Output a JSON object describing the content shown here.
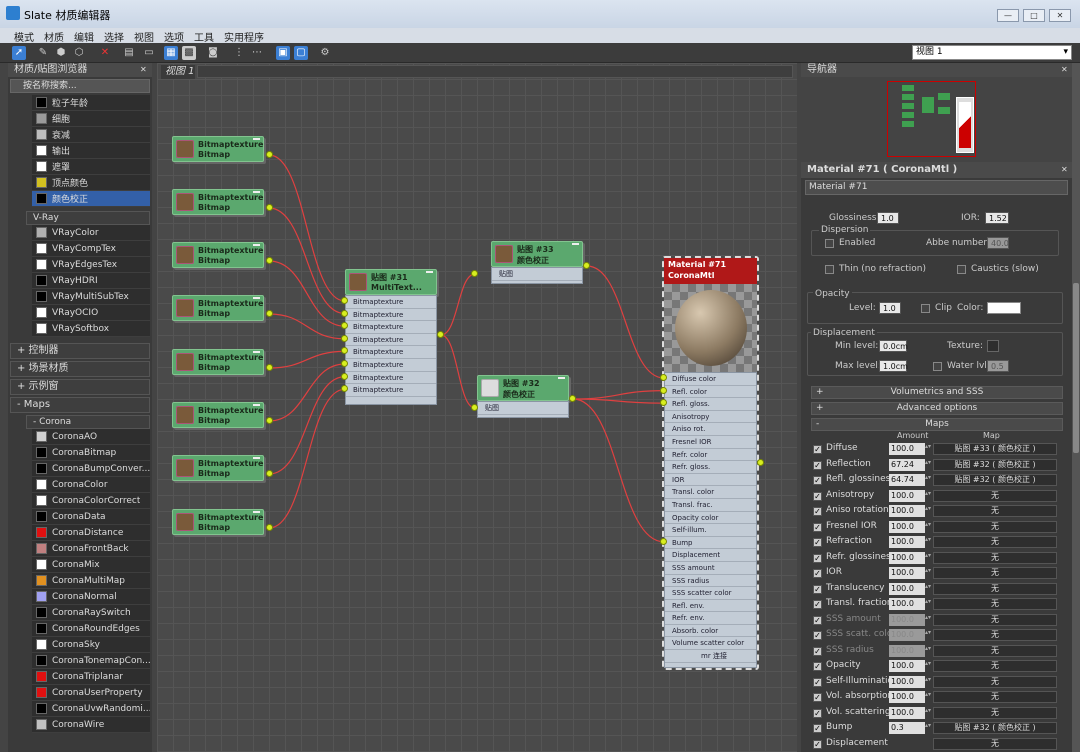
{
  "window": {
    "title": "Slate 材质编辑器"
  },
  "menu": [
    "模式",
    "材质",
    "编辑",
    "选择",
    "视图",
    "选项",
    "工具",
    "实用程序"
  ],
  "toolbar": {
    "view_select": "视图 1"
  },
  "browser": {
    "title": "材质/贴图浏览器",
    "search": "按名称搜索...",
    "items_top": [
      {
        "label": "粒子年龄",
        "color": "#000000"
      },
      {
        "label": "细胞",
        "color": "#9a9a9a"
      },
      {
        "label": "衰减",
        "color": "#bdbdbd"
      },
      {
        "label": "输出",
        "color": "#ffffff"
      },
      {
        "label": "遮罩",
        "color": "#ffffff"
      },
      {
        "label": "顶点颜色",
        "color": "#d2c020"
      },
      {
        "label": "颜色校正",
        "color": "#000000"
      }
    ],
    "vray_label": "V-Ray",
    "vray_items": [
      {
        "label": "VRayColor",
        "color": "#b0b0b0"
      },
      {
        "label": "VRayCompTex",
        "color": "#ffffff"
      },
      {
        "label": "VRayEdgesTex",
        "color": "#ffffff"
      },
      {
        "label": "VRayHDRI",
        "color": "#000000"
      },
      {
        "label": "VRayMultiSubTex",
        "color": "#000000"
      },
      {
        "label": "VRayOCIO",
        "color": "#ffffff"
      },
      {
        "label": "VRaySoftbox",
        "color": "#ffffff"
      }
    ],
    "sections": [
      "+ 控制器",
      "+ 场景材质",
      "+ 示例窗"
    ],
    "maps_label": "- Maps",
    "corona_label": "- Corona",
    "corona_items": [
      {
        "label": "CoronaAO",
        "color": "#d0d0d0"
      },
      {
        "label": "CoronaBitmap",
        "color": "#000000"
      },
      {
        "label": "CoronaBumpConver...",
        "color": "#000000"
      },
      {
        "label": "CoronaColor",
        "color": "#ffffff"
      },
      {
        "label": "CoronaColorCorrect",
        "color": "#ffffff"
      },
      {
        "label": "CoronaData",
        "color": "#000000"
      },
      {
        "label": "CoronaDistance",
        "color": "#e01010"
      },
      {
        "label": "CoronaFrontBack",
        "color": "#c08080"
      },
      {
        "label": "CoronaMix",
        "color": "#ffffff"
      },
      {
        "label": "CoronaMultiMap",
        "color": "#e09020"
      },
      {
        "label": "CoronaNormal",
        "color": "#a0a0f0"
      },
      {
        "label": "CoronaRaySwitch",
        "color": "#000000"
      },
      {
        "label": "CoronaRoundEdges",
        "color": "#000000"
      },
      {
        "label": "CoronaSky",
        "color": "#ffffff"
      },
      {
        "label": "CoronaTonemapCon...",
        "color": "#000000"
      },
      {
        "label": "CoronaTriplanar",
        "color": "#e01010"
      },
      {
        "label": "CoronaUserProperty",
        "color": "#e01010"
      },
      {
        "label": "CoronaUvwRandomi...",
        "color": "#000000"
      },
      {
        "label": "CoronaWire",
        "color": "#c0c0c0"
      }
    ]
  },
  "graph": {
    "tab": "视图 1",
    "bitmap_node": {
      "line1": "Bitmaptexture",
      "line2": "Bitmap"
    },
    "multi_node": {
      "line1": "贴图 #31",
      "line2": "MultiText...",
      "slot_label": "Bitmaptexture"
    },
    "cc33": {
      "line1": "贴图 #33",
      "line2": "颜色校正",
      "slot": "贴图"
    },
    "cc32": {
      "line1": "贴图 #32",
      "line2": "颜色校正",
      "slot": "贴图"
    },
    "material": {
      "line1": "Material #71",
      "line2": "CoronaMtl",
      "footer": "mr 连接",
      "slots": [
        "Diffuse color",
        "Refl. color",
        "Refl. gloss.",
        "Anisotropy",
        "Aniso rot.",
        "Fresnel IOR",
        "Refr. color",
        "Refr. gloss.",
        "IOR",
        "Transl. color",
        "Transl. frac.",
        "Opacity color",
        "Self-illum.",
        "Bump",
        "Displacement",
        "SSS amount",
        "SSS radius",
        "SSS scatter color",
        "Refl. env.",
        "Refr. env.",
        "Absorb. color",
        "Volume scatter color"
      ]
    }
  },
  "navigator": {
    "title": "导航器"
  },
  "props": {
    "header": "Material #71  ( CoronaMtl )",
    "name_field": "Material #71",
    "glossiness_label": "Glossiness:",
    "glossiness": "1.0",
    "ior_label": "IOR:",
    "ior": "1.52",
    "dispersion_label": "Dispersion",
    "enabled_label": "Enabled",
    "abbe_label": "Abbe number:",
    "abbe": "40.0",
    "thin_label": "Thin (no refraction)",
    "caustics_label": "Caustics (slow)",
    "opacity_label": "Opacity",
    "level_label": "Level:",
    "level": "1.0",
    "clip_label": "Clip",
    "color_label": "Color:",
    "displacement_label": "Displacement",
    "min_label": "Min level:",
    "min": "0.0cm",
    "texture_label": "Texture:",
    "max_label": "Max level:",
    "max": "1.0cm",
    "water_label": "Water lvl.",
    "water": "0.5",
    "vol_label": "Volumetrics and SSS",
    "adv_label": "Advanced options",
    "maps_label": "Maps",
    "amount_col": "Amount",
    "map_col": "Map",
    "rows": [
      {
        "name": "Diffuse",
        "amount": "100.0",
        "map": "贴图 #33 ( 颜色校正 )",
        "enabled": true
      },
      {
        "name": "Reflection",
        "amount": "67.24",
        "map": "贴图 #32 ( 颜色校正 )",
        "enabled": true
      },
      {
        "name": "Refl. glossiness",
        "amount": "64.74",
        "map": "贴图 #32 ( 颜色校正 )",
        "enabled": true
      },
      {
        "name": "Anisotropy",
        "amount": "100.0",
        "map": "无",
        "enabled": true
      },
      {
        "name": "Aniso rotation",
        "amount": "100.0",
        "map": "无",
        "enabled": true
      },
      {
        "name": "Fresnel IOR",
        "amount": "100.0",
        "map": "无",
        "enabled": true
      },
      {
        "name": "Refraction",
        "amount": "100.0",
        "map": "无",
        "enabled": true
      },
      {
        "name": "Refr. glossiness",
        "amount": "100.0",
        "map": "无",
        "enabled": true
      },
      {
        "name": "IOR",
        "amount": "100.0",
        "map": "无",
        "enabled": true
      },
      {
        "name": "Translucency",
        "amount": "100.0",
        "map": "无",
        "enabled": true
      },
      {
        "name": "Transl. fraction",
        "amount": "100.0",
        "map": "无",
        "enabled": true
      },
      {
        "name": "SSS amount",
        "amount": "100.0",
        "map": "无",
        "enabled": false
      },
      {
        "name": "SSS scatt. color",
        "amount": "100.0",
        "map": "无",
        "enabled": false
      },
      {
        "name": "SSS radius",
        "amount": "100.0",
        "map": "无",
        "enabled": false
      },
      {
        "name": "Opacity",
        "amount": "100.0",
        "map": "无",
        "enabled": true
      },
      {
        "name": "Self-Illumination",
        "amount": "100.0",
        "map": "无",
        "enabled": true
      },
      {
        "name": "Vol. absorption",
        "amount": "100.0",
        "map": "无",
        "enabled": true
      },
      {
        "name": "Vol. scattering",
        "amount": "100.0",
        "map": "无",
        "enabled": true
      },
      {
        "name": "Bump",
        "amount": "0.3",
        "map": "贴图 #32 ( 颜色校正 )",
        "enabled": true
      },
      {
        "name": "Displacement",
        "amount": "",
        "map": "无",
        "enabled": true
      }
    ]
  }
}
